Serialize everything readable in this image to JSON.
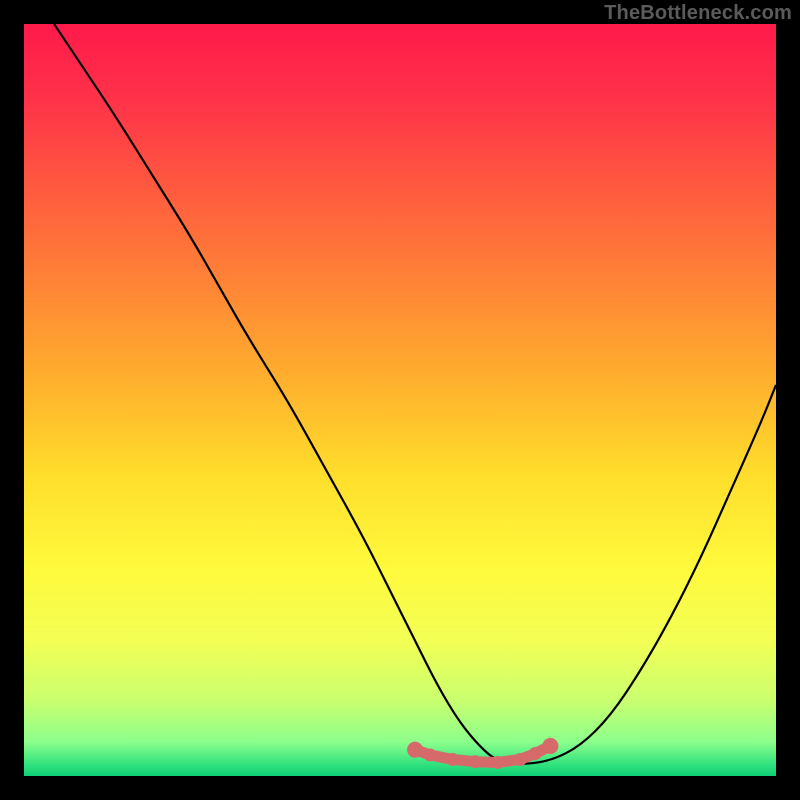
{
  "watermark": "TheBottleneck.com",
  "chart_data": {
    "type": "line",
    "title": "",
    "xlabel": "",
    "ylabel": "",
    "xlim": [
      0,
      100
    ],
    "ylim": [
      0,
      100
    ],
    "series": [
      {
        "name": "curve",
        "x": [
          4,
          8,
          12,
          17,
          22,
          26,
          30,
          35,
          40,
          45,
          49,
          52,
          55,
          58,
          61,
          63,
          66,
          70,
          74,
          78,
          82,
          86,
          90,
          94,
          98,
          100
        ],
        "y": [
          100,
          94,
          88,
          80,
          72,
          65,
          58,
          50,
          41,
          32,
          24,
          18,
          12,
          7,
          3.5,
          2,
          1.5,
          2,
          4,
          8,
          14,
          21,
          29,
          38,
          47,
          52
        ]
      },
      {
        "name": "markers",
        "x": [
          52,
          54,
          57,
          60,
          63,
          66,
          68,
          70
        ],
        "y": [
          3.5,
          2.8,
          2.2,
          1.9,
          1.8,
          2.2,
          3,
          4
        ]
      }
    ],
    "gradient_stops": [
      {
        "offset": 0.0,
        "color": "#ff1a4b"
      },
      {
        "offset": 0.1,
        "color": "#ff3249"
      },
      {
        "offset": 0.22,
        "color": "#ff5a3f"
      },
      {
        "offset": 0.35,
        "color": "#ff8636"
      },
      {
        "offset": 0.48,
        "color": "#ffb22d"
      },
      {
        "offset": 0.6,
        "color": "#ffde2c"
      },
      {
        "offset": 0.72,
        "color": "#fff93b"
      },
      {
        "offset": 0.82,
        "color": "#f3ff55"
      },
      {
        "offset": 0.9,
        "color": "#c9ff6f"
      },
      {
        "offset": 0.955,
        "color": "#8cff8c"
      },
      {
        "offset": 0.985,
        "color": "#30e27e"
      },
      {
        "offset": 1.0,
        "color": "#0ece74"
      }
    ],
    "marker_color": "#d66a6a",
    "curve_color": "#000000"
  }
}
